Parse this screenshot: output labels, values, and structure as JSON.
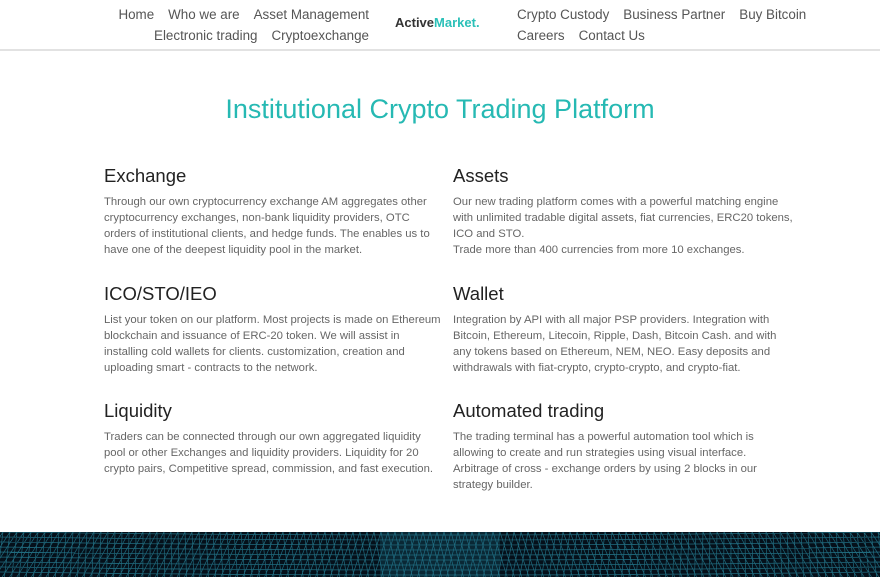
{
  "header": {
    "nav_left": [
      "Home",
      "Who we are",
      "Asset Management",
      "Electronic trading",
      "Cryptoexchange"
    ],
    "logo": {
      "main": "Active",
      "accent": "Market."
    },
    "nav_right": [
      "Crypto Custody",
      "Business Partner",
      "Buy Bitcoin",
      "Careers",
      "Contact Us"
    ]
  },
  "main": {
    "title": "Institutional Crypto Trading Platform",
    "features": [
      {
        "heading": "Exchange",
        "text": "Through our own cryptocurrency exchange AM aggregates other cryptocurrency exchanges, non-bank liquidity providers, OTC orders of institutional clients, and hedge funds. The enables us to have one of the deepest liquidity pool in the market."
      },
      {
        "heading": "Assets",
        "text": "Our new trading platform comes with a powerful matching engine with unlimited tradable digital assets, fiat currencies, ERC20 tokens, ICO and STO.",
        "text2": "Trade more than 400 currencies from more 10 exchanges."
      },
      {
        "heading": "ICO/STO/IEO",
        "text": "List your token on our platform. Most projects is made on Ethereum blockchain and issuance of ERC-20 token. We will assist in installing cold wallets for clients. customization, creation and uploading smart - contracts to the network."
      },
      {
        "heading": "Wallet",
        "text": "Integration by API with all major PSP providers. Integration with Bitcoin, Ethereum, Litecoin, Ripple, Dash, Bitcoin Cash. and with any tokens based on Ethereum, NEM, NEO. Easy deposits and withdrawals with fiat-crypto, crypto-crypto, and crypto-fiat."
      },
      {
        "heading": "Liquidity",
        "text": "Traders can be connected through our own aggregated liquidity pool or other Exchanges and liquidity providers. Liquidity for 20 crypto pairs, Competitive spread, commission, and fast execution."
      },
      {
        "heading": "Automated trading",
        "text": "The trading terminal has a powerful automation tool which is allowing to create and run strategies using visual interface. Arbitrage of cross - exchange orders by using 2 blocks in our strategy builder."
      }
    ]
  },
  "colors": {
    "accent": "#26b9b3",
    "grid_line": "#2a8aa0",
    "banner_bg": "#05101a"
  }
}
